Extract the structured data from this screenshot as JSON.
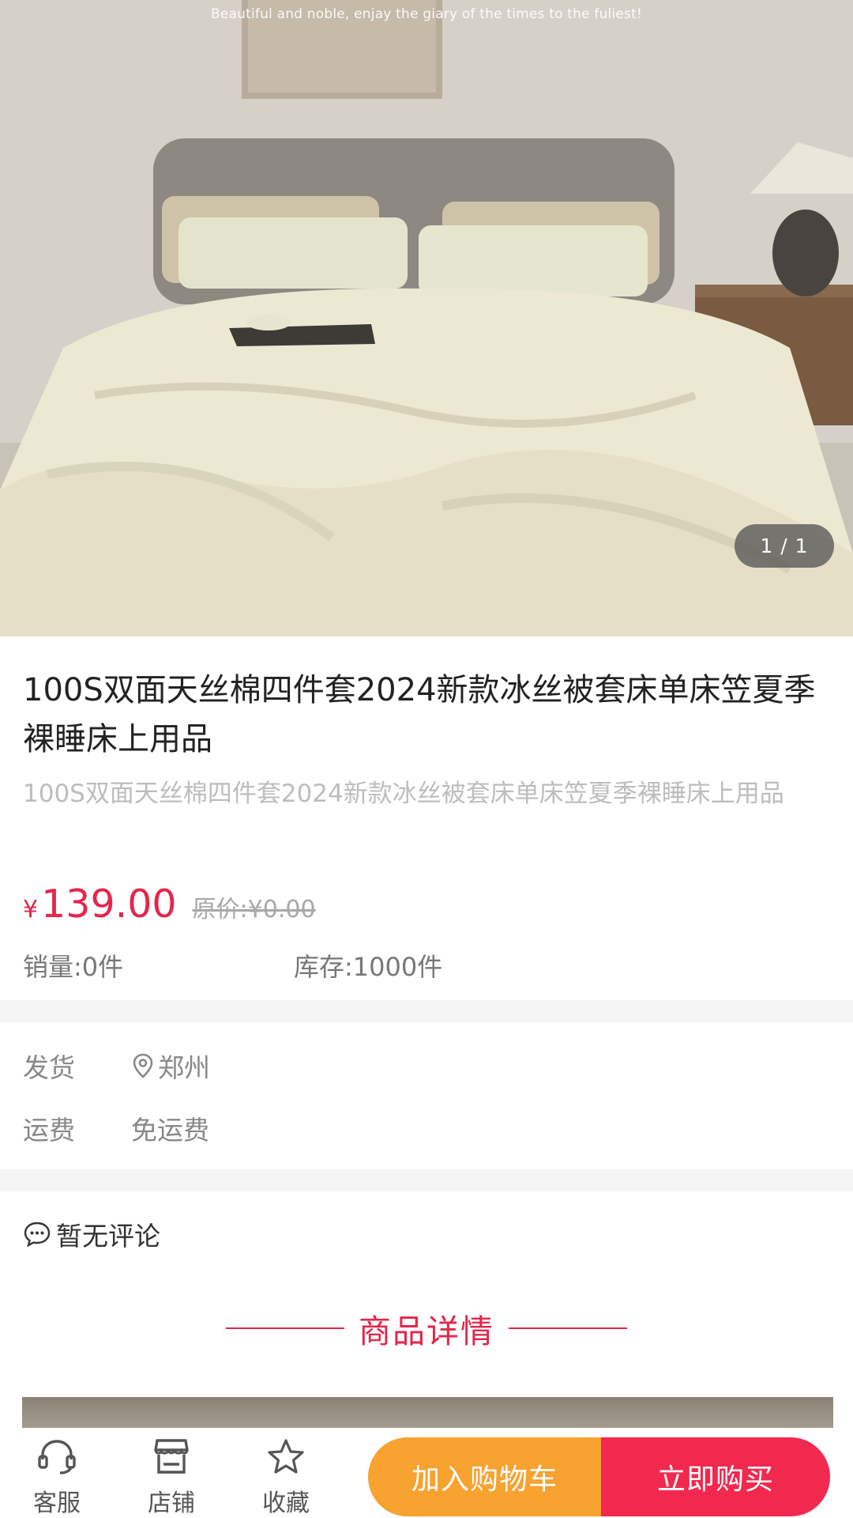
{
  "hero": {
    "tagline": "Beautiful and noble, enjay the giary of the times to the fuliest!",
    "counter": "1 / 1"
  },
  "product": {
    "title": "100S双面天丝棉四件套2024新款冰丝被套床单床笠夏季裸睡床上用品",
    "subtitle": "100S双面天丝棉四件套2024新款冰丝被套床单床笠夏季裸睡床上用品",
    "currency": "¥",
    "price": "139.00",
    "original_label": "原价:",
    "original_price": "¥0.00",
    "sales": "销量:0件",
    "stock": "库存:1000件"
  },
  "shipping": {
    "origin_label": "发货",
    "origin_value": "郑州",
    "fee_label": "运费",
    "fee_value": "免运费"
  },
  "reviews": {
    "text": "暂无评论"
  },
  "details": {
    "heading": "商品详情"
  },
  "bottom_bar": {
    "service": "客服",
    "store": "店铺",
    "favorite": "收藏",
    "add_to_cart": "加入购物车",
    "buy_now": "立即购买"
  },
  "colors": {
    "accent": "#e4264b",
    "cart_button": "#f8a230",
    "buy_button": "#f2294f"
  },
  "icons": [
    "headset-icon",
    "store-icon",
    "star-icon",
    "location-pin-icon",
    "comment-icon"
  ]
}
